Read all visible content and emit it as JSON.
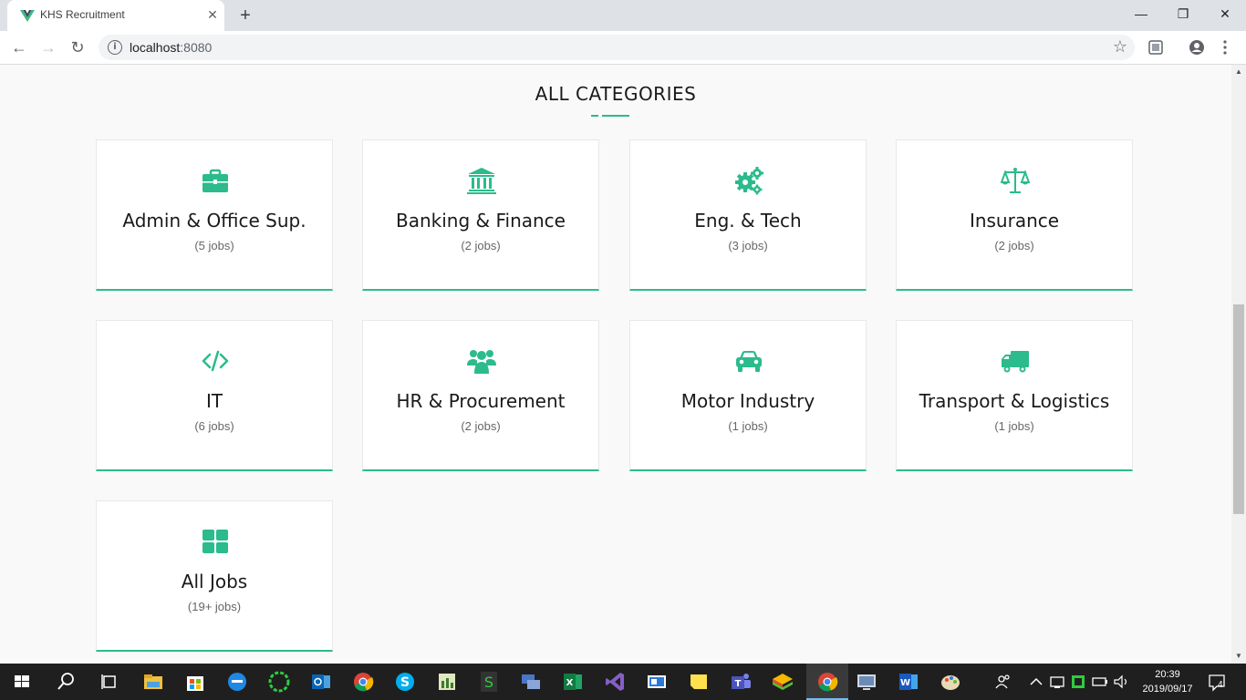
{
  "browser": {
    "tab_title": "KHS Recruitment",
    "url_host": "localhost",
    "url_port": ":8080",
    "info_glyph": "i",
    "close_glyph": "✕",
    "newtab_glyph": "+",
    "back_glyph": "←",
    "forward_glyph": "→",
    "reload_glyph": "↻",
    "star_glyph": "☆",
    "minimize_glyph": "—",
    "restore_glyph": "❐",
    "window_close_glyph": "✕"
  },
  "page": {
    "section_title": "ALL CATEGORIES",
    "accent_color": "#2bbb8c"
  },
  "categories": [
    {
      "title": "Admin & Office Sup.",
      "count": "(5 jobs)",
      "icon": "briefcase-icon"
    },
    {
      "title": "Banking & Finance",
      "count": "(2 jobs)",
      "icon": "bank-icon"
    },
    {
      "title": "Eng. & Tech",
      "count": "(3 jobs)",
      "icon": "gears-icon"
    },
    {
      "title": "Insurance",
      "count": "(2 jobs)",
      "icon": "balance-scale-icon"
    },
    {
      "title": "IT",
      "count": "(6 jobs)",
      "icon": "code-icon"
    },
    {
      "title": "HR & Procurement",
      "count": "(2 jobs)",
      "icon": "users-icon"
    },
    {
      "title": "Motor Industry",
      "count": "(1 jobs)",
      "icon": "car-icon"
    },
    {
      "title": "Transport & Logistics",
      "count": "(1 jobs)",
      "icon": "truck-icon"
    },
    {
      "title": "All Jobs",
      "count": "(19+ jobs)",
      "icon": "grid-icon"
    }
  ],
  "taskbar": {
    "time": "20:39",
    "date": "2019/09/17",
    "notifications": "4",
    "apps": [
      "start-icon",
      "search-icon",
      "task-view-icon",
      "file-explorer-icon",
      "store-icon",
      "edge-icon",
      "green-circle-app-icon",
      "outlook-icon",
      "chrome-icon",
      "skype-icon",
      "sheets-app-icon",
      "sage-app-icon",
      "network-app-icon",
      "excel-icon",
      "visual-studio-icon",
      "window-app-icon",
      "sticky-notes-icon",
      "teams-icon",
      "stack-app-icon",
      "chrome-active-icon",
      "remote-desktop-icon",
      "word-icon",
      "paint-icon"
    ]
  }
}
